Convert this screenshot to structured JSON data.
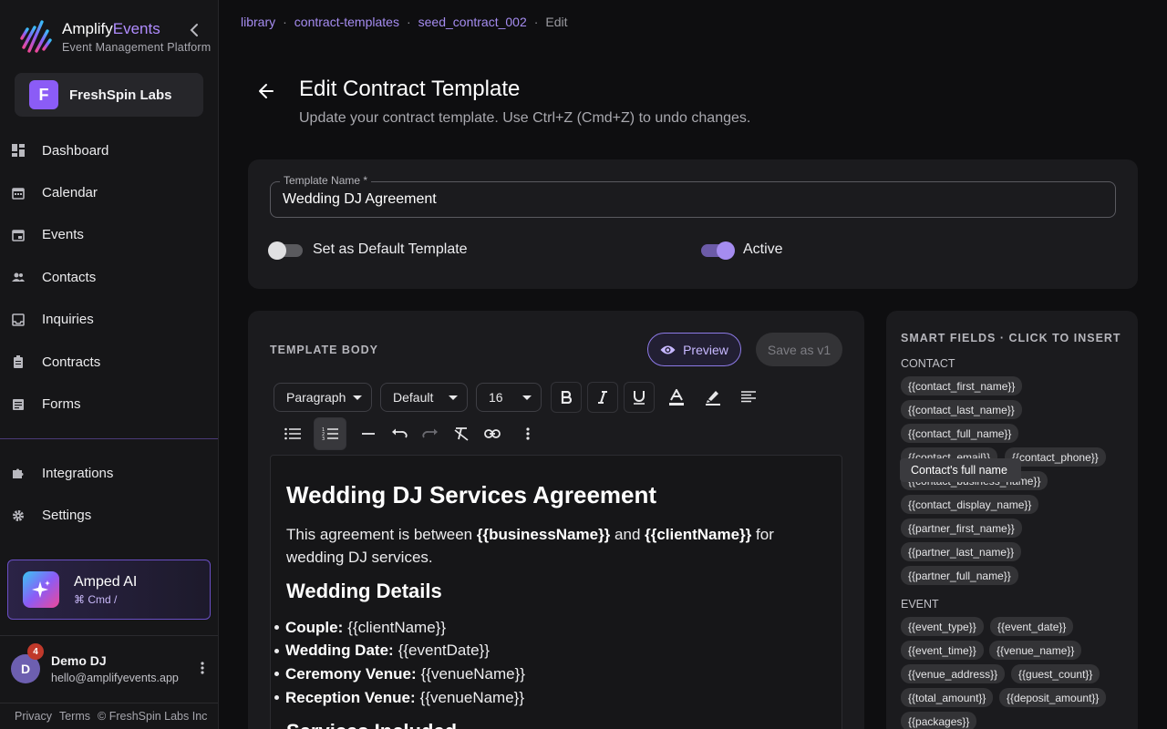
{
  "brand": {
    "name_part1": "Amplify",
    "name_part2": "Events",
    "subtitle": "Event Management Platform"
  },
  "org": {
    "initial": "F",
    "name": "FreshSpin Labs"
  },
  "nav": {
    "items": [
      {
        "label": "Dashboard",
        "icon": "dashboard-icon"
      },
      {
        "label": "Calendar",
        "icon": "calendar-icon"
      },
      {
        "label": "Events",
        "icon": "event-icon"
      },
      {
        "label": "Contacts",
        "icon": "people-icon"
      },
      {
        "label": "Inquiries",
        "icon": "inbox-icon"
      },
      {
        "label": "Contracts",
        "icon": "clipboard-icon"
      },
      {
        "label": "Forms",
        "icon": "form-icon"
      }
    ],
    "secondary": [
      {
        "label": "Integrations",
        "icon": "puzzle-icon"
      },
      {
        "label": "Settings",
        "icon": "gear-icon"
      }
    ]
  },
  "ai": {
    "title": "Amped AI",
    "shortcut": "⌘ Cmd /"
  },
  "user": {
    "initial": "D",
    "notifications": "4",
    "name": "Demo DJ",
    "email": "hello@amplifyevents.app"
  },
  "footer": {
    "privacy": "Privacy",
    "terms": "Terms",
    "copyright": "© FreshSpin Labs Inc"
  },
  "breadcrumb": {
    "items": [
      "library",
      "contract-templates",
      "seed_contract_002"
    ],
    "current": "Edit",
    "separator": "·"
  },
  "page": {
    "title": "Edit Contract Template",
    "subtitle": "Update your contract template. Use Ctrl+Z (Cmd+Z) to undo changes."
  },
  "form": {
    "name_label": "Template Name *",
    "name_value": "Wedding DJ Agreement",
    "default_label": "Set as Default Template",
    "default_on": false,
    "active_label": "Active",
    "active_on": true
  },
  "body": {
    "section_title": "TEMPLATE BODY",
    "preview_label": "Preview",
    "save_label": "Save as v1",
    "toolbar": {
      "block_type": "Paragraph",
      "font": "Default",
      "size": "16"
    },
    "content": {
      "h1": "Wedding DJ Services Agreement",
      "p_before": "This agreement is between ",
      "p_var1": "{{businessName}}",
      "p_mid": " and ",
      "p_var2": "{{clientName}}",
      "p_after": " for wedding DJ services.",
      "h2": "Wedding Details",
      "list": [
        {
          "label": "Couple:",
          "value": "{{clientName}}"
        },
        {
          "label": "Wedding Date:",
          "value": "{{eventDate}}"
        },
        {
          "label": "Ceremony Venue:",
          "value": "{{venueName}}"
        },
        {
          "label": "Reception Venue:",
          "value": "{{venueName}}"
        }
      ],
      "h2b": "Services Included"
    }
  },
  "smart_fields": {
    "title": "SMART FIELDS · CLICK TO INSERT",
    "contact_group": "CONTACT",
    "contact": [
      "{{contact_first_name}}",
      "{{contact_last_name}}",
      "{{contact_full_name}}",
      "{{contact_email}}",
      "{{contact_phone}}",
      "{{contact_business_name}}",
      "{{contact_display_name}}",
      "{{partner_first_name}}",
      "{{partner_last_name}}",
      "{{partner_full_name}}"
    ],
    "event_group": "EVENT",
    "event": [
      "{{event_type}}",
      "{{event_date}}",
      "{{event_time}}",
      "{{venue_name}}",
      "{{venue_address}}",
      "{{guest_count}}",
      "{{total_amount}}",
      "{{deposit_amount}}",
      "{{packages}}"
    ],
    "tooltip": "Contact's full name"
  },
  "colors": {
    "accent": "#8b5cf6",
    "accent_light": "#a58cf0",
    "background": "#0e0e10",
    "card": "#1b1b1e"
  }
}
